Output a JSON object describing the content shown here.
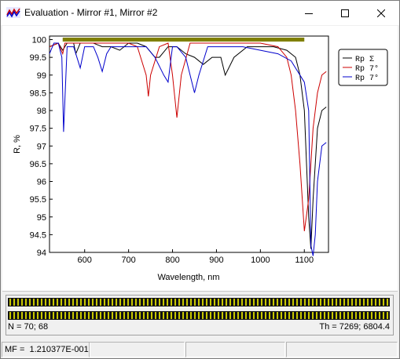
{
  "window": {
    "title": "Evaluation - Mirror #1, Mirror #2"
  },
  "legend": [
    {
      "label": "Rp  Σ",
      "color": "#000000"
    },
    {
      "label": "Rp  7°",
      "color": "#cc0000"
    },
    {
      "label": "Rp  7°",
      "color": "#0000cc"
    }
  ],
  "info": {
    "n_text": "N = 70; 68",
    "th_text": "Th = 7269; 6804.4"
  },
  "status": {
    "mf_text": "MF =  1.210377E-001"
  },
  "colors": {
    "target_band": "#808000",
    "stripe_dark": "#111111",
    "stripe_light": "#c8c800"
  },
  "chart_data": {
    "type": "line",
    "xlabel": "Wavelength, nm",
    "ylabel": "R, %",
    "xlim": [
      520,
      1155
    ],
    "ylim": [
      94,
      100.1
    ],
    "xticks": [
      "600",
      "700",
      "800",
      "900",
      "1000",
      "1100"
    ],
    "yticks": [
      "100",
      "99.5",
      "99",
      "98.5",
      "98",
      "97.5",
      "97",
      "96.5",
      "96",
      "95.5",
      "95",
      "94.5",
      "94"
    ],
    "target": {
      "x": [
        550,
        1100
      ],
      "y": 100
    },
    "series": [
      {
        "name": "Rp  Σ",
        "color": "#000000",
        "x": [
          520,
          540,
          550,
          560,
          575,
          580,
          590,
          600,
          620,
          640,
          660,
          680,
          700,
          720,
          740,
          760,
          770,
          790,
          810,
          830,
          850,
          870,
          890,
          910,
          920,
          940,
          970,
          1000,
          1030,
          1060,
          1080,
          1090,
          1100,
          1110,
          1115,
          1120,
          1130,
          1140,
          1150
        ],
        "y": [
          99.8,
          99.9,
          99.7,
          99.9,
          99.9,
          99.6,
          99.9,
          99.9,
          99.9,
          99.8,
          99.8,
          99.7,
          99.9,
          99.9,
          99.8,
          99.5,
          99.5,
          99.8,
          99.8,
          99.6,
          99.5,
          99.3,
          99.5,
          99.5,
          99.0,
          99.5,
          99.8,
          99.8,
          99.8,
          99.7,
          99.5,
          99.0,
          98.0,
          95.0,
          94.1,
          95.5,
          97.5,
          98.0,
          98.1
        ]
      },
      {
        "name": "Rp  7°",
        "color": "#cc0000",
        "x": [
          520,
          540,
          550,
          555,
          560,
          580,
          600,
          620,
          640,
          660,
          680,
          700,
          720,
          740,
          745,
          750,
          770,
          790,
          800,
          810,
          820,
          840,
          860,
          880,
          900,
          930,
          960,
          1000,
          1040,
          1060,
          1070,
          1080,
          1090,
          1100,
          1110,
          1120,
          1130,
          1140,
          1150
        ],
        "y": [
          99.8,
          99.9,
          99.6,
          99.9,
          99.9,
          99.9,
          99.9,
          99.9,
          99.9,
          99.9,
          99.9,
          99.9,
          99.8,
          99.0,
          98.4,
          99.0,
          99.8,
          99.9,
          99.0,
          97.8,
          99.0,
          99.9,
          99.9,
          99.9,
          99.9,
          99.9,
          99.9,
          99.9,
          99.8,
          99.5,
          99.0,
          98.0,
          96.5,
          94.6,
          95.5,
          97.5,
          98.5,
          99.0,
          99.1
        ]
      },
      {
        "name": "Rp  7°",
        "color": "#0000cc",
        "x": [
          520,
          530,
          540,
          548,
          552,
          560,
          575,
          585,
          590,
          600,
          620,
          630,
          640,
          650,
          660,
          680,
          700,
          720,
          740,
          760,
          780,
          790,
          800,
          810,
          830,
          850,
          860,
          880,
          900,
          930,
          960,
          1000,
          1040,
          1070,
          1090,
          1100,
          1110,
          1115,
          1120,
          1125,
          1130,
          1140,
          1150
        ],
        "y": [
          99.6,
          99.9,
          99.9,
          99.5,
          97.4,
          99.8,
          99.8,
          99.4,
          99.2,
          99.8,
          99.8,
          99.5,
          99.1,
          99.6,
          99.8,
          99.8,
          99.8,
          99.8,
          99.8,
          99.5,
          99.0,
          98.8,
          99.8,
          99.8,
          99.5,
          98.5,
          99.0,
          99.8,
          99.8,
          99.8,
          99.8,
          99.7,
          99.6,
          99.4,
          99.0,
          98.8,
          98.0,
          94.2,
          93.9,
          94.5,
          96.0,
          97.0,
          97.1
        ]
      }
    ]
  }
}
